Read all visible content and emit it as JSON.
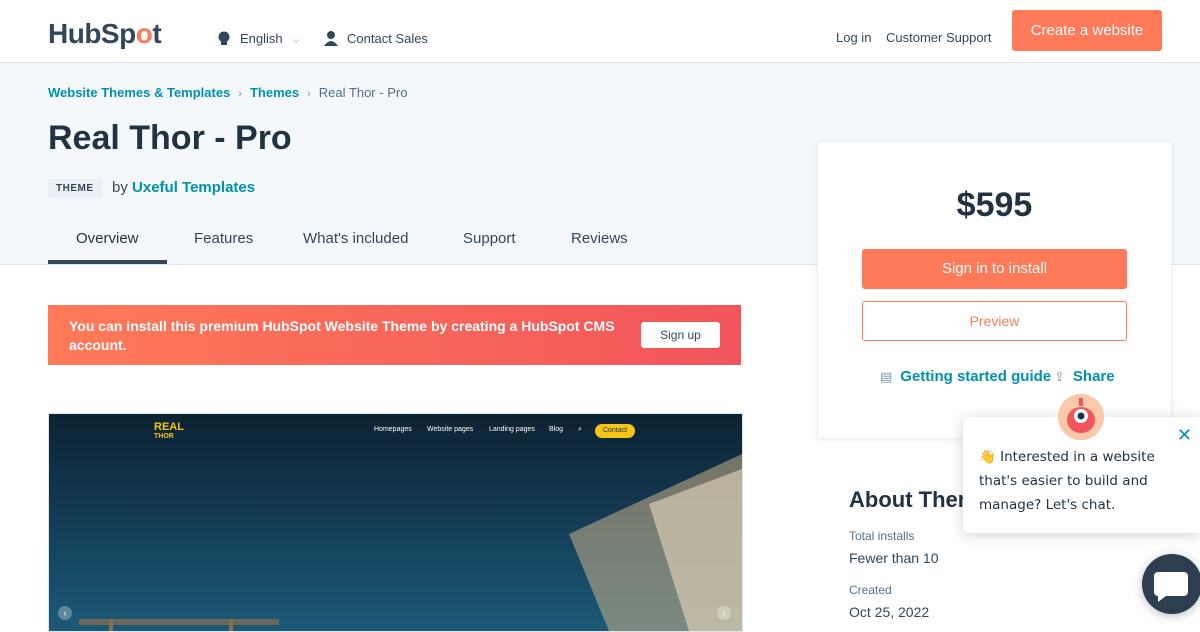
{
  "nav": {
    "logo": {
      "prefix": "HubSp",
      "o": "o",
      "suffix": "t"
    },
    "language": "English",
    "contact_sales": "Contact Sales",
    "log_in": "Log in",
    "customer_support": "Customer Support",
    "cta": "Create a website"
  },
  "breadcrumb": {
    "items": [
      "Website Themes & Templates",
      "Themes"
    ],
    "current": "Real Thor - Pro"
  },
  "hero": {
    "title": "Real Thor - Pro",
    "badge": "THEME",
    "by": "by",
    "author": "Uxeful Templates"
  },
  "tabs": [
    "Overview",
    "Features",
    "What's included",
    "Support",
    "Reviews"
  ],
  "banner": {
    "message": "You can install this premium HubSpot Website Theme by creating a HubSpot CMS account.",
    "button": "Sign up"
  },
  "preview_image": {
    "logo_top": "REAL",
    "logo_bottom": "THOR",
    "nav": [
      "Homepages",
      "Website pages",
      "Landing pages",
      "Blog"
    ],
    "contact": "Contact"
  },
  "card": {
    "price": "$595",
    "install": "Sign in to install",
    "preview": "Preview",
    "guide": "Getting started guide",
    "share": "Share"
  },
  "about": {
    "heading": "About Theme",
    "installs_label": "Total installs",
    "installs_value": "Fewer than 10",
    "created_label": "Created",
    "created_value": "Oct 25, 2022"
  },
  "chat": {
    "message": "👋 Interested in a website that's easier to build and manage? Let's chat."
  },
  "colors": {
    "accent": "#ff7a59",
    "link": "#0091ae",
    "text": "#33475b",
    "hero_bg": "#f5f8fa"
  }
}
